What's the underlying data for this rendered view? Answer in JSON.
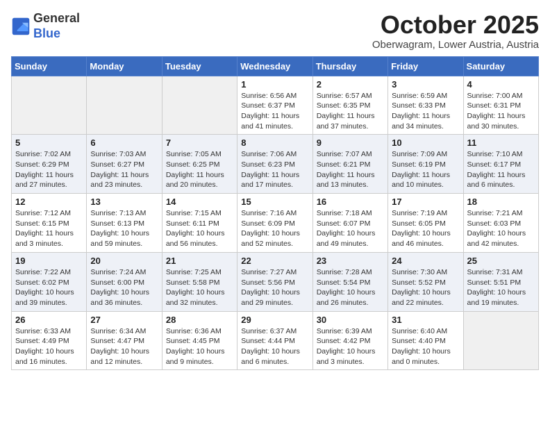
{
  "header": {
    "logo_line1": "General",
    "logo_line2": "Blue",
    "month": "October 2025",
    "location": "Oberwagram, Lower Austria, Austria"
  },
  "weekdays": [
    "Sunday",
    "Monday",
    "Tuesday",
    "Wednesday",
    "Thursday",
    "Friday",
    "Saturday"
  ],
  "weeks": [
    [
      {
        "day": "",
        "info": ""
      },
      {
        "day": "",
        "info": ""
      },
      {
        "day": "",
        "info": ""
      },
      {
        "day": "1",
        "info": "Sunrise: 6:56 AM\nSunset: 6:37 PM\nDaylight: 11 hours\nand 41 minutes."
      },
      {
        "day": "2",
        "info": "Sunrise: 6:57 AM\nSunset: 6:35 PM\nDaylight: 11 hours\nand 37 minutes."
      },
      {
        "day": "3",
        "info": "Sunrise: 6:59 AM\nSunset: 6:33 PM\nDaylight: 11 hours\nand 34 minutes."
      },
      {
        "day": "4",
        "info": "Sunrise: 7:00 AM\nSunset: 6:31 PM\nDaylight: 11 hours\nand 30 minutes."
      }
    ],
    [
      {
        "day": "5",
        "info": "Sunrise: 7:02 AM\nSunset: 6:29 PM\nDaylight: 11 hours\nand 27 minutes."
      },
      {
        "day": "6",
        "info": "Sunrise: 7:03 AM\nSunset: 6:27 PM\nDaylight: 11 hours\nand 23 minutes."
      },
      {
        "day": "7",
        "info": "Sunrise: 7:05 AM\nSunset: 6:25 PM\nDaylight: 11 hours\nand 20 minutes."
      },
      {
        "day": "8",
        "info": "Sunrise: 7:06 AM\nSunset: 6:23 PM\nDaylight: 11 hours\nand 17 minutes."
      },
      {
        "day": "9",
        "info": "Sunrise: 7:07 AM\nSunset: 6:21 PM\nDaylight: 11 hours\nand 13 minutes."
      },
      {
        "day": "10",
        "info": "Sunrise: 7:09 AM\nSunset: 6:19 PM\nDaylight: 11 hours\nand 10 minutes."
      },
      {
        "day": "11",
        "info": "Sunrise: 7:10 AM\nSunset: 6:17 PM\nDaylight: 11 hours\nand 6 minutes."
      }
    ],
    [
      {
        "day": "12",
        "info": "Sunrise: 7:12 AM\nSunset: 6:15 PM\nDaylight: 11 hours\nand 3 minutes."
      },
      {
        "day": "13",
        "info": "Sunrise: 7:13 AM\nSunset: 6:13 PM\nDaylight: 10 hours\nand 59 minutes."
      },
      {
        "day": "14",
        "info": "Sunrise: 7:15 AM\nSunset: 6:11 PM\nDaylight: 10 hours\nand 56 minutes."
      },
      {
        "day": "15",
        "info": "Sunrise: 7:16 AM\nSunset: 6:09 PM\nDaylight: 10 hours\nand 52 minutes."
      },
      {
        "day": "16",
        "info": "Sunrise: 7:18 AM\nSunset: 6:07 PM\nDaylight: 10 hours\nand 49 minutes."
      },
      {
        "day": "17",
        "info": "Sunrise: 7:19 AM\nSunset: 6:05 PM\nDaylight: 10 hours\nand 46 minutes."
      },
      {
        "day": "18",
        "info": "Sunrise: 7:21 AM\nSunset: 6:03 PM\nDaylight: 10 hours\nand 42 minutes."
      }
    ],
    [
      {
        "day": "19",
        "info": "Sunrise: 7:22 AM\nSunset: 6:02 PM\nDaylight: 10 hours\nand 39 minutes."
      },
      {
        "day": "20",
        "info": "Sunrise: 7:24 AM\nSunset: 6:00 PM\nDaylight: 10 hours\nand 36 minutes."
      },
      {
        "day": "21",
        "info": "Sunrise: 7:25 AM\nSunset: 5:58 PM\nDaylight: 10 hours\nand 32 minutes."
      },
      {
        "day": "22",
        "info": "Sunrise: 7:27 AM\nSunset: 5:56 PM\nDaylight: 10 hours\nand 29 minutes."
      },
      {
        "day": "23",
        "info": "Sunrise: 7:28 AM\nSunset: 5:54 PM\nDaylight: 10 hours\nand 26 minutes."
      },
      {
        "day": "24",
        "info": "Sunrise: 7:30 AM\nSunset: 5:52 PM\nDaylight: 10 hours\nand 22 minutes."
      },
      {
        "day": "25",
        "info": "Sunrise: 7:31 AM\nSunset: 5:51 PM\nDaylight: 10 hours\nand 19 minutes."
      }
    ],
    [
      {
        "day": "26",
        "info": "Sunrise: 6:33 AM\nSunset: 4:49 PM\nDaylight: 10 hours\nand 16 minutes."
      },
      {
        "day": "27",
        "info": "Sunrise: 6:34 AM\nSunset: 4:47 PM\nDaylight: 10 hours\nand 12 minutes."
      },
      {
        "day": "28",
        "info": "Sunrise: 6:36 AM\nSunset: 4:45 PM\nDaylight: 10 hours\nand 9 minutes."
      },
      {
        "day": "29",
        "info": "Sunrise: 6:37 AM\nSunset: 4:44 PM\nDaylight: 10 hours\nand 6 minutes."
      },
      {
        "day": "30",
        "info": "Sunrise: 6:39 AM\nSunset: 4:42 PM\nDaylight: 10 hours\nand 3 minutes."
      },
      {
        "day": "31",
        "info": "Sunrise: 6:40 AM\nSunset: 4:40 PM\nDaylight: 10 hours\nand 0 minutes."
      },
      {
        "day": "",
        "info": ""
      }
    ]
  ]
}
